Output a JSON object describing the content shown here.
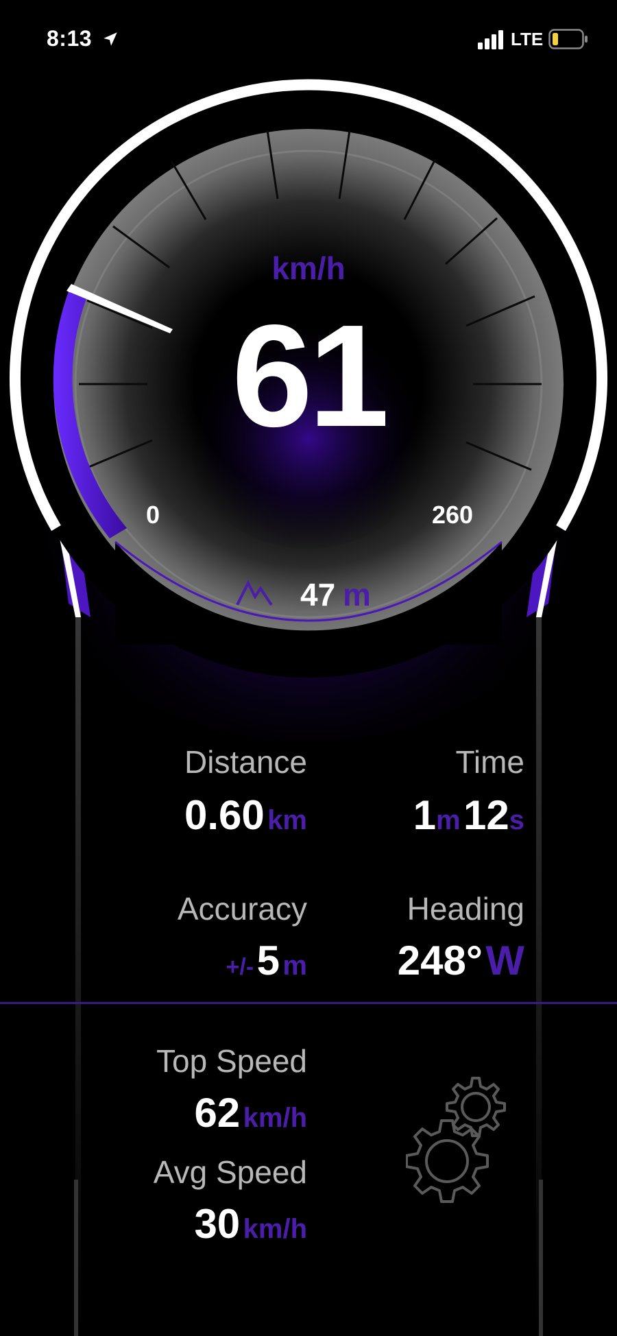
{
  "status_bar": {
    "time": "8:13",
    "network": "LTE",
    "location_icon": "location-arrow-icon",
    "signal_icon": "cellular-signal-icon",
    "battery_icon": "battery-low-icon"
  },
  "gauge": {
    "unit": "km/h",
    "speed": "61",
    "min_label": "0",
    "max_label": "260",
    "speed_fraction": 0.235,
    "accent_color": "#5a1fd0"
  },
  "altitude": {
    "icon": "mountain-icon",
    "value": "47",
    "unit": "m"
  },
  "stats": {
    "distance": {
      "label": "Distance",
      "value": "0.60",
      "unit": "km"
    },
    "time": {
      "label": "Time",
      "minutes": "1",
      "minutes_unit": "m",
      "seconds": "12",
      "seconds_unit": "s"
    },
    "accuracy": {
      "label": "Accuracy",
      "prefix": "+/-",
      "value": "5",
      "unit": "m"
    },
    "heading": {
      "label": "Heading",
      "value": "248°",
      "direction": "W"
    },
    "top_speed": {
      "label": "Top Speed",
      "value": "62",
      "unit": "km/h"
    },
    "avg_speed": {
      "label": "Avg Speed",
      "value": "30",
      "unit": "km/h"
    }
  },
  "settings": {
    "icon": "gears-icon"
  }
}
